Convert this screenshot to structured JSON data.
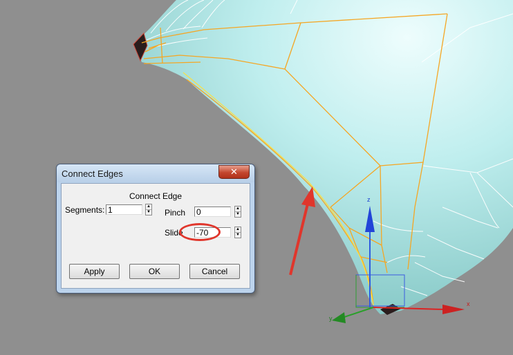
{
  "dialog": {
    "title": "Connect Edges",
    "group_label": "Connect Edge",
    "segments": {
      "label": "Segments:",
      "value": "1"
    },
    "pinch": {
      "label": "Pinch",
      "value": "0"
    },
    "slide": {
      "label": "Slide",
      "value": "-70"
    },
    "buttons": {
      "apply": "Apply",
      "ok": "OK",
      "cancel": "Cancel"
    },
    "close_glyph": "✕"
  },
  "gizmo": {
    "x_label": "x",
    "y_label": "y",
    "z_label": "z"
  },
  "colors": {
    "background": "#8f8f8f",
    "mesh": "#a9e3e0",
    "selected_edges": "#f5a623",
    "annotation": "#e0362c"
  }
}
